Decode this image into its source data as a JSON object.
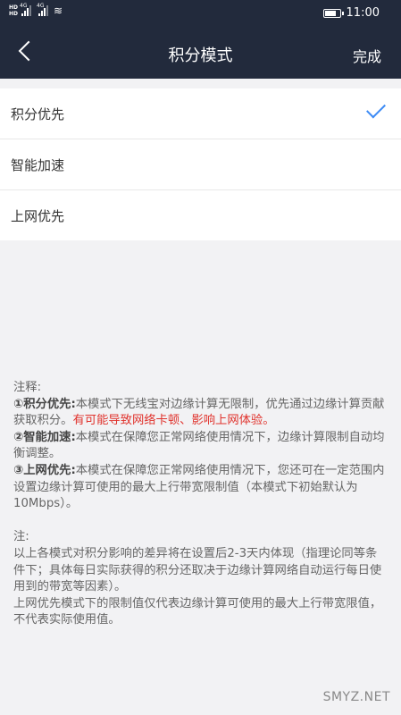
{
  "status_bar": {
    "hd_labels": [
      "HD",
      "HD"
    ],
    "network_labels": [
      "4G",
      "4G"
    ],
    "signal_levels": [
      0.75,
      0.75
    ],
    "wifi_icon": "wifi-icon",
    "battery_level": 0.85,
    "time": "11:00"
  },
  "nav": {
    "title": "积分模式",
    "done_label": "完成",
    "back_icon": "back-chevron-icon",
    "bg_color": "#222a3c"
  },
  "modes": [
    {
      "label": "积分优先",
      "selected": true
    },
    {
      "label": "智能加速",
      "selected": false
    },
    {
      "label": "上网优先",
      "selected": false
    }
  ],
  "notes": {
    "heading": "注释:",
    "item1_title": "①积分优先:",
    "item1_text": "本模式下无线宝对边缘计算无限制，优先通过边缘计算贡献获取积分。",
    "item1_warning": "有可能导致网络卡顿、影响上网体验。",
    "item2_title": "②智能加速:",
    "item2_text": "本模式在保障您正常网络使用情况下，边缘计算限制自动均衡调整。",
    "item3_title": "③上网优先:",
    "item3_text": "本模式在保障您正常网络使用情况下，您还可在一定范围内设置边缘计算可使用的最大上行带宽限制值（本模式下初始默认为10Mbps）。",
    "note_heading": "注:",
    "note1": "以上各模式对积分影响的差异将在设置后2-3天内体现（指理论同等条件下；具体每日实际获得的积分还取决于边缘计算网络自动运行每日使用到的带宽等因素）。",
    "note2": "上网优先模式下的限制值仅代表边缘计算可使用的最大上行带宽限值，不代表实际使用值。"
  },
  "watermark": "SMYZ.NET",
  "colors": {
    "accent": "#3d8bf5",
    "warning": "#e0332d"
  }
}
